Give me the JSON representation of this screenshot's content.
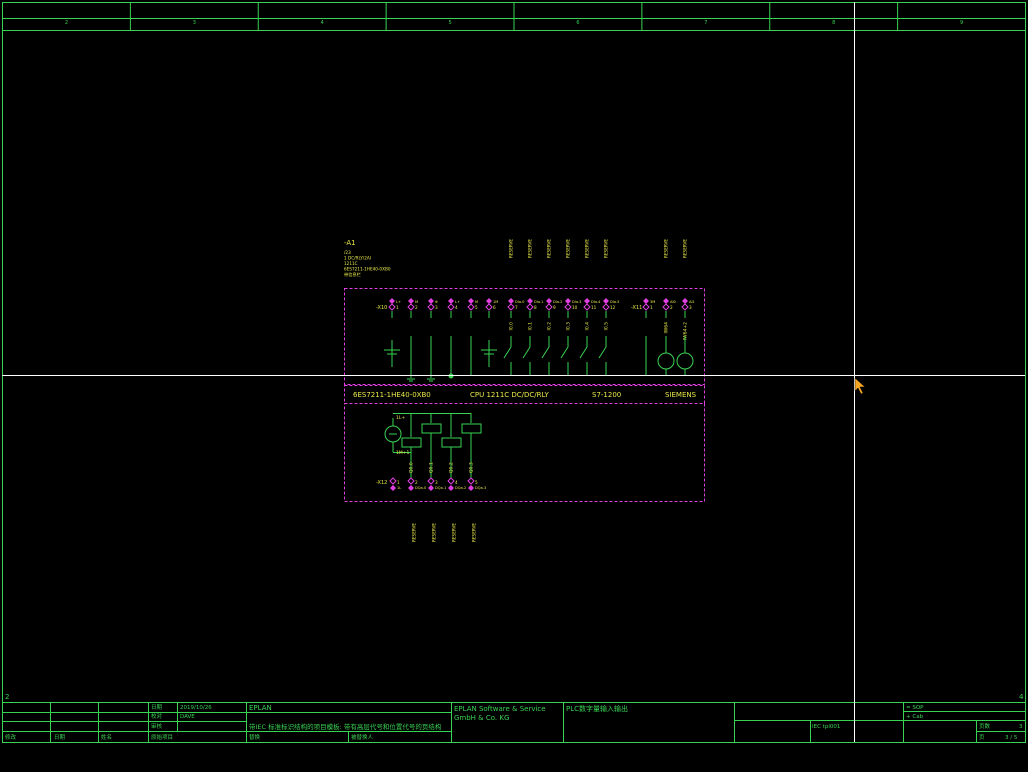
{
  "colors": {
    "frame": "#39d353",
    "yellow": "#e8e84a",
    "magenta": "#e040e0",
    "cursor_line": "#ffffff",
    "cursor_pointer": "#f5a623",
    "background": "#000000"
  },
  "ruler": {
    "columns": [
      "2",
      "3",
      "4",
      "5",
      "6",
      "7",
      "8",
      "9"
    ]
  },
  "side_marks": {
    "left": "2",
    "right": "4"
  },
  "device": {
    "tag": "-A1",
    "info_lines": [
      "/23",
      "1 DC/RLY/2AI",
      "1211C",
      "6ES7211-1HE40-0XB0",
      "带信息栏"
    ],
    "order_no": "6ES7211-1HE40-0XB0",
    "model": "CPU 1211C DC/DC/RLY",
    "family": "S7-1200",
    "vendor": "SIEMENS"
  },
  "top_strip": {
    "connector": "-X10",
    "connector2": "-X11",
    "pins": [
      {
        "name": "L+",
        "num": "1"
      },
      {
        "name": "M",
        "num": "2"
      },
      {
        "name": "⊕",
        "num": "3"
      },
      {
        "name": "L+",
        "num": "4"
      },
      {
        "name": "M",
        "num": "5"
      },
      {
        "name": "1M",
        "num": "6"
      },
      {
        "name": "DIa.0",
        "num": "7"
      },
      {
        "name": "DIa.1",
        "num": "8"
      },
      {
        "name": "DIa.2",
        "num": "9"
      },
      {
        "name": "DIa.3",
        "num": "10"
      },
      {
        "name": "DIa.4",
        "num": "11"
      },
      {
        "name": "DIa.5",
        "num": "12"
      },
      {
        "name": "3M",
        "num": "1"
      },
      {
        "name": "AI0",
        "num": "2"
      },
      {
        "name": "AI1",
        "num": "3"
      }
    ],
    "addresses": [
      "I0.0",
      "I0.1",
      "I0.2",
      "I0.3",
      "I0.4",
      "I0.5",
      "IW64",
      "IW64+2"
    ],
    "reserve_labels": [
      "RESERVE",
      "RESERVE",
      "RESERVE",
      "RESERVE",
      "RESERVE",
      "RESERVE",
      "RESERVE",
      "RESERVE"
    ]
  },
  "bottom_strip": {
    "connector": "-X12",
    "supply_labels": [
      "1L+",
      "1M+1"
    ],
    "pins": [
      {
        "name": "1L",
        "num": "1"
      },
      {
        "name": "DQa.0",
        "num": "2"
      },
      {
        "name": "DQa.1",
        "num": "3"
      },
      {
        "name": "DQa.2",
        "num": "4"
      },
      {
        "name": "DQa.3",
        "num": "5"
      }
    ],
    "addresses": [
      "Q0.0",
      "Q0.1",
      "Q0.2",
      "Q0.3"
    ],
    "reserve_labels": [
      "RESERVE",
      "RESERVE",
      "RESERVE",
      "RESERVE"
    ]
  },
  "title_block": {
    "row_labels": [
      "日期",
      "校对",
      "审核"
    ],
    "date": "2019/10/26",
    "user": "DAVE",
    "rev_labels": [
      "修改",
      "日期",
      "姓名",
      "原始项目"
    ],
    "company_short": "EPLAN",
    "project_desc": "带IEC 标准标识结构的项目模板: 带有高层代号和位置代号的页结构",
    "edit_label": "替换",
    "editor_label": "被替换人",
    "company_full_1": "EPLAN Software & Service",
    "company_full_2": "GmbH & Co. KG",
    "page_title": "PLC数字量输入输出",
    "standard": "IEC tpl001",
    "ref1": "= SOP",
    "ref2": "+ Cab",
    "page_label": "页数",
    "page_value": "3",
    "page_of_label": "页",
    "page_of_value": "3 / 5"
  }
}
